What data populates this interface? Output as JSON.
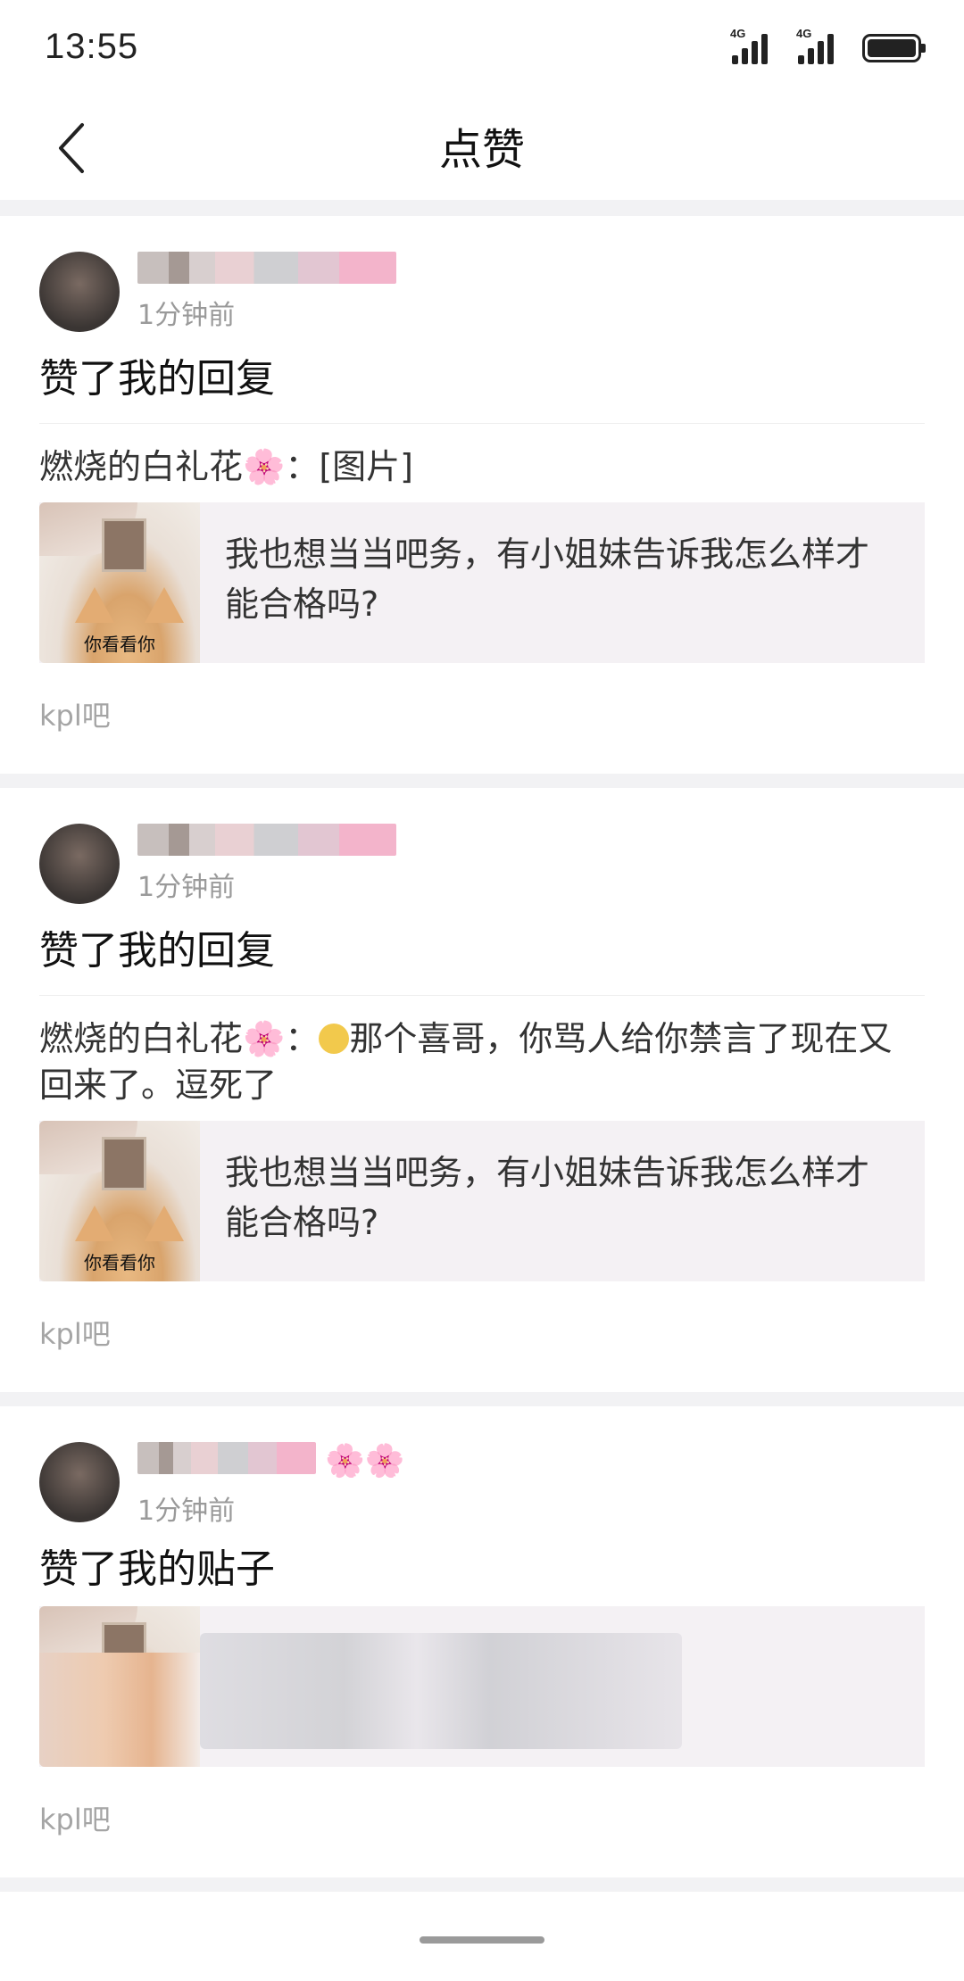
{
  "status_bar": {
    "time": "13:55",
    "signal1_label": "4G",
    "signal2_label": "4G",
    "icons": [
      "signal-icon",
      "signal-icon",
      "battery-icon"
    ]
  },
  "nav": {
    "title": "点赞",
    "back_icon": "chevron-left-icon"
  },
  "items": [
    {
      "time": "1分钟前",
      "action": "赞了我的回复",
      "reply": "燃烧的白礼花🌸：[图片]",
      "thumb_caption": "你看看你",
      "quote": "我也想当当吧务，有小姐妹告诉我怎么样才能合格吗?",
      "forum": "kpl吧"
    },
    {
      "time": "1分钟前",
      "action": "赞了我的回复",
      "reply_prefix": "燃烧的白礼花🌸：",
      "reply_emoji": "sneezing-face-emoji",
      "reply": "那个喜哥，你骂人给你禁言了现在又回来了。逗死了",
      "thumb_caption": "你看看你",
      "quote": "我也想当当吧务，有小姐妹告诉我怎么样才能合格吗?",
      "forum": "kpl吧"
    },
    {
      "time": "1分钟前",
      "user_suffix": "🌸🌸",
      "action": "赞了我的贴子",
      "forum": "kpl吧"
    }
  ],
  "colors": {
    "background": "#f2f2f4",
    "card": "#ffffff",
    "quote_bg": "#f4f1f4",
    "muted_text": "#9a9a9a"
  }
}
